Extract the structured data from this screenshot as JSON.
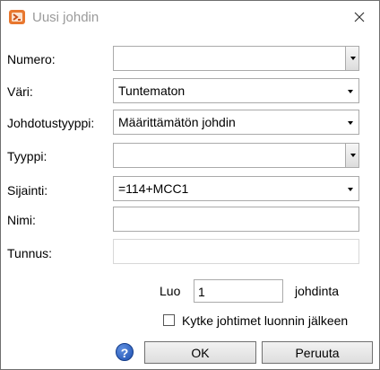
{
  "window": {
    "title": "Uusi johdin",
    "icon": "app-icon",
    "close_icon": "close-icon"
  },
  "form": {
    "numero": {
      "label": "Numero:",
      "value": ""
    },
    "vari": {
      "label": "Väri:",
      "value": "Tuntematon"
    },
    "johdotustyyppi": {
      "label": "Johdotustyyppi:",
      "value": "Määrittämätön johdin"
    },
    "tyyppi": {
      "label": "Tyyppi:",
      "value": ""
    },
    "sijainti": {
      "label": "Sijainti:",
      "value": "=114+MCC1"
    },
    "nimi": {
      "label": "Nimi:",
      "value": ""
    },
    "tunnus": {
      "label": "Tunnus:",
      "value": ""
    }
  },
  "create": {
    "prefix": "Luo",
    "count": "1",
    "suffix": "johdinta"
  },
  "checkbox": {
    "label": "Kytke johtimet luonnin jälkeen",
    "checked": false
  },
  "buttons": {
    "help": "?",
    "ok": "OK",
    "cancel": "Peruuta"
  }
}
